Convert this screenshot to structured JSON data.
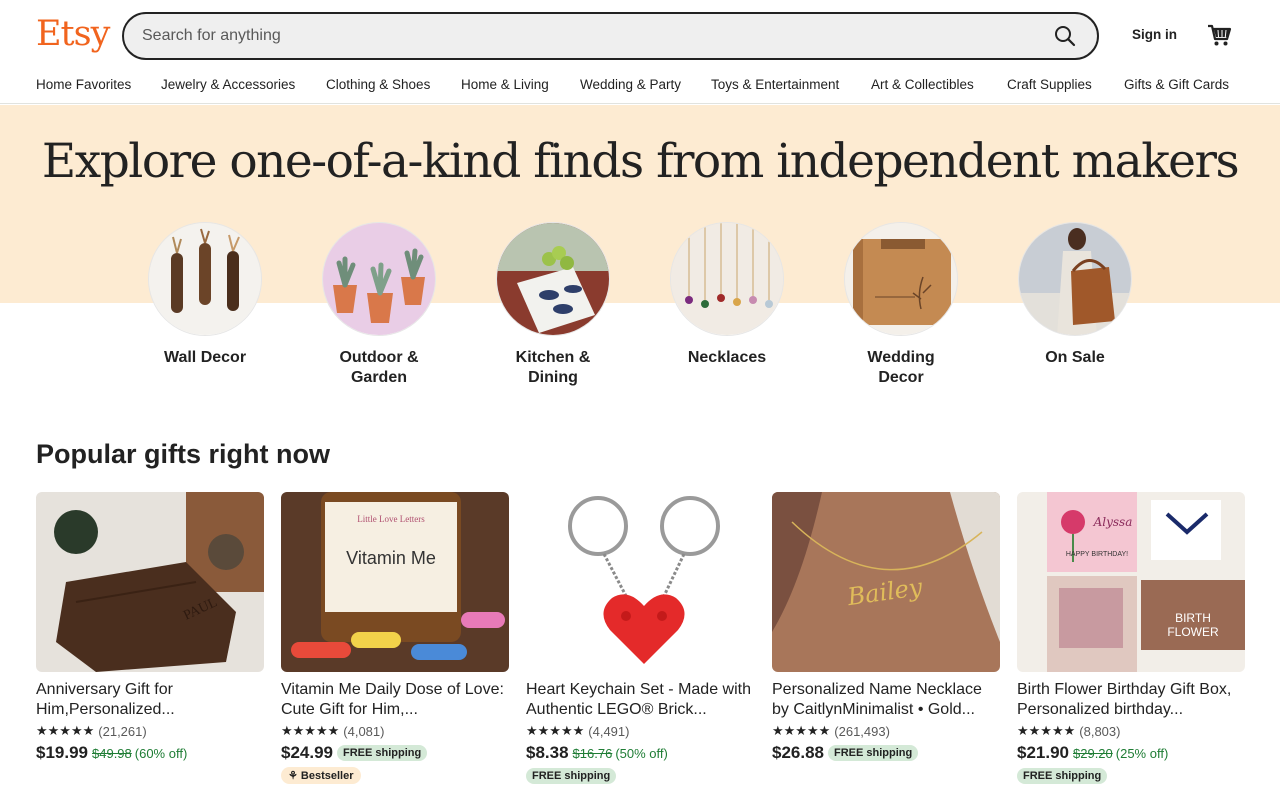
{
  "header": {
    "logo": "Etsy",
    "search_placeholder": "Search for anything",
    "signin_label": "Sign in",
    "brand_color": "#f1641e"
  },
  "nav": {
    "items": [
      {
        "label": "Home Favorites"
      },
      {
        "label": "Jewelry & Accessories"
      },
      {
        "label": "Clothing & Shoes"
      },
      {
        "label": "Home & Living"
      },
      {
        "label": "Wedding & Party"
      },
      {
        "label": "Toys & Entertainment"
      },
      {
        "label": "Art & Collectibles"
      },
      {
        "label": "Craft Supplies"
      },
      {
        "label": "Gifts & Gift Cards"
      }
    ]
  },
  "hero": {
    "title": "Explore one-of-a-kind finds from independent makers",
    "band_color": "#fdebd2",
    "categories": [
      {
        "label": "Wall Decor"
      },
      {
        "label": "Outdoor &\nGarden"
      },
      {
        "label": "Kitchen &\nDining"
      },
      {
        "label": "Necklaces"
      },
      {
        "label": "Wedding\nDecor"
      },
      {
        "label": "On Sale"
      }
    ]
  },
  "popular": {
    "title": "Popular gifts right now",
    "products": [
      {
        "title": "Anniversary Gift for Him,Personalized...",
        "stars": "★★★★★",
        "reviews": "(21,261)",
        "price": "$19.99",
        "original": "$49.98",
        "discount": "(60% off)",
        "shipping": "",
        "badge": ""
      },
      {
        "title": "Vitamin Me Daily Dose of Love: Cute Gift for Him,...",
        "stars": "★★★★★",
        "reviews": "(4,081)",
        "price": "$24.99",
        "original": "",
        "discount": "",
        "shipping": "FREE shipping",
        "badge": "Bestseller"
      },
      {
        "title": "Heart Keychain Set - Made with Authentic LEGO® Brick...",
        "stars": "★★★★★",
        "reviews": "(4,491)",
        "price": "$8.38",
        "original": "$16.76",
        "discount": "(50% off)",
        "shipping": "FREE shipping",
        "badge": ""
      },
      {
        "title": "Personalized Name Necklace by CaitlynMinimalist • Gold...",
        "stars": "★★★★★",
        "reviews": "(261,493)",
        "price": "$26.88",
        "original": "",
        "discount": "",
        "shipping": "FREE shipping",
        "badge": ""
      },
      {
        "title": "Birth Flower Birthday Gift Box, Personalized birthday...",
        "stars": "★★★★★",
        "reviews": "(8,803)",
        "price": "$21.90",
        "original": "$29.20",
        "discount": "(25% off)",
        "shipping": "FREE shipping",
        "badge": ""
      }
    ],
    "image_texts": {
      "wallet_name": "PAUL",
      "vitamin_brand": "Little Love Letters",
      "vitamin_title": "Vitamin Me",
      "necklace_name": "Bailey",
      "gift_name": "Alyssa",
      "gift_bday": "HAPPY BIRTHDAY!",
      "gift_birth": "BIRTH",
      "gift_flower": "FLOWER"
    }
  }
}
